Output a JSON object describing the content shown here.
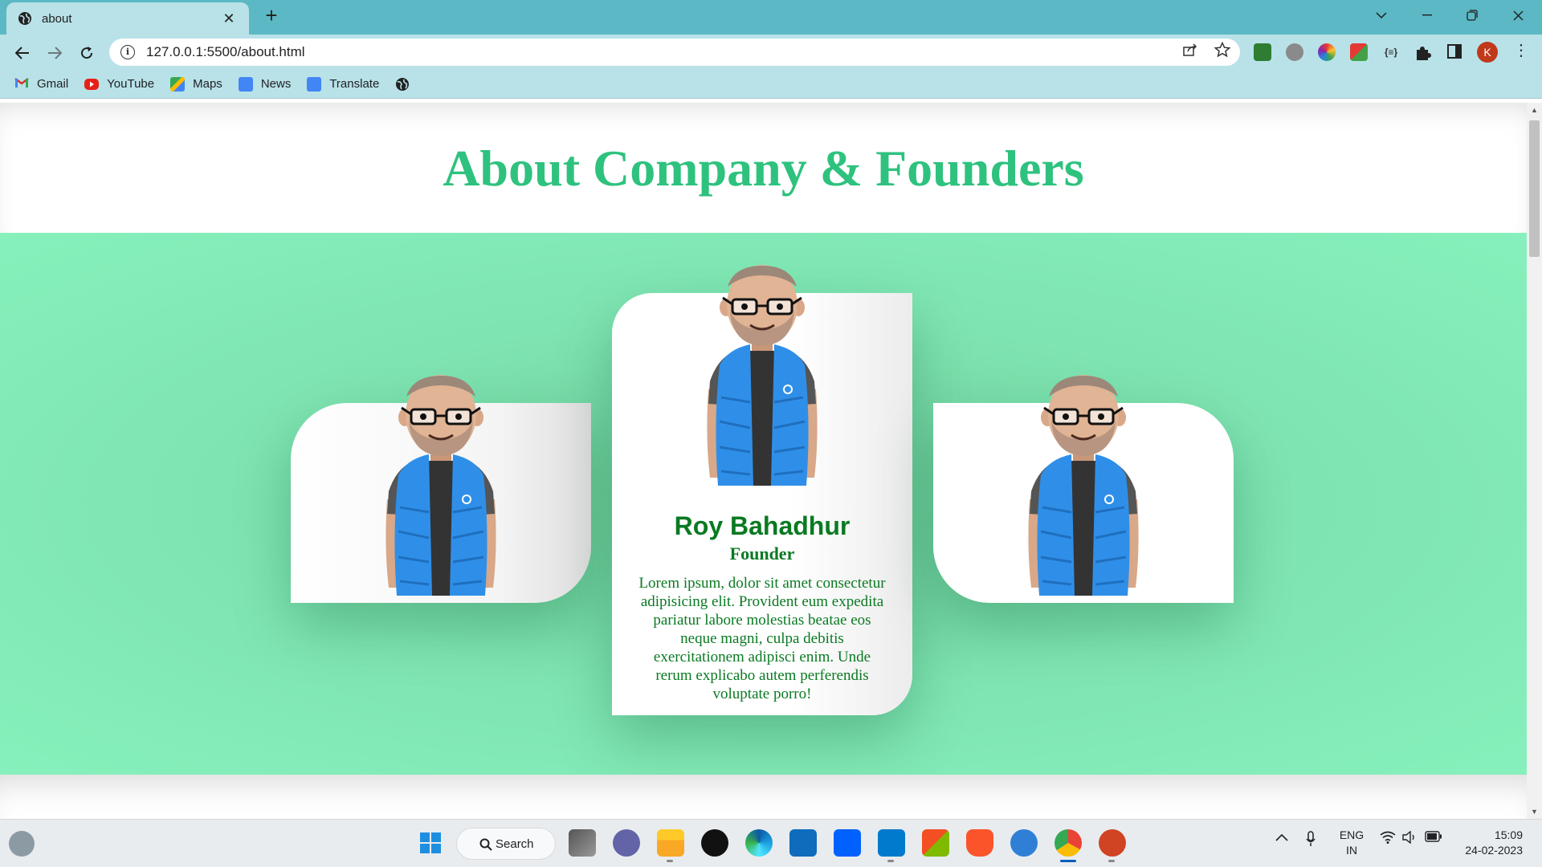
{
  "browser": {
    "tab_title": "about",
    "tab_close": "✕",
    "new_tab": "+",
    "url": "127.0.0.1:5500/about.html",
    "profile_initial": "K",
    "bookmarks": [
      "Gmail",
      "YouTube",
      "Maps",
      "News",
      "Translate"
    ]
  },
  "page": {
    "heading": "About Company & Founders",
    "featured": {
      "name": "Roy Bahadhur",
      "role": "Founder",
      "description": "Lorem ipsum, dolor sit amet consectetur adipisicing elit. Provident eum expedita pariatur labore molestias beatae eos neque magni, culpa debitis exercitationem adipisci enim. Unde rerum explicabo autem perferendis voluptate porro!"
    }
  },
  "taskbar": {
    "search_label": "Search",
    "lang_line1": "ENG",
    "lang_line2": "IN",
    "time": "15:09",
    "date": "24-02-2023"
  },
  "colors": {
    "heading": "#2ec27e",
    "section_bg": "#86f1bc",
    "card_text": "#0a7a22",
    "tab_strip": "#5bb8c4",
    "toolbar": "#b8e2e8"
  }
}
